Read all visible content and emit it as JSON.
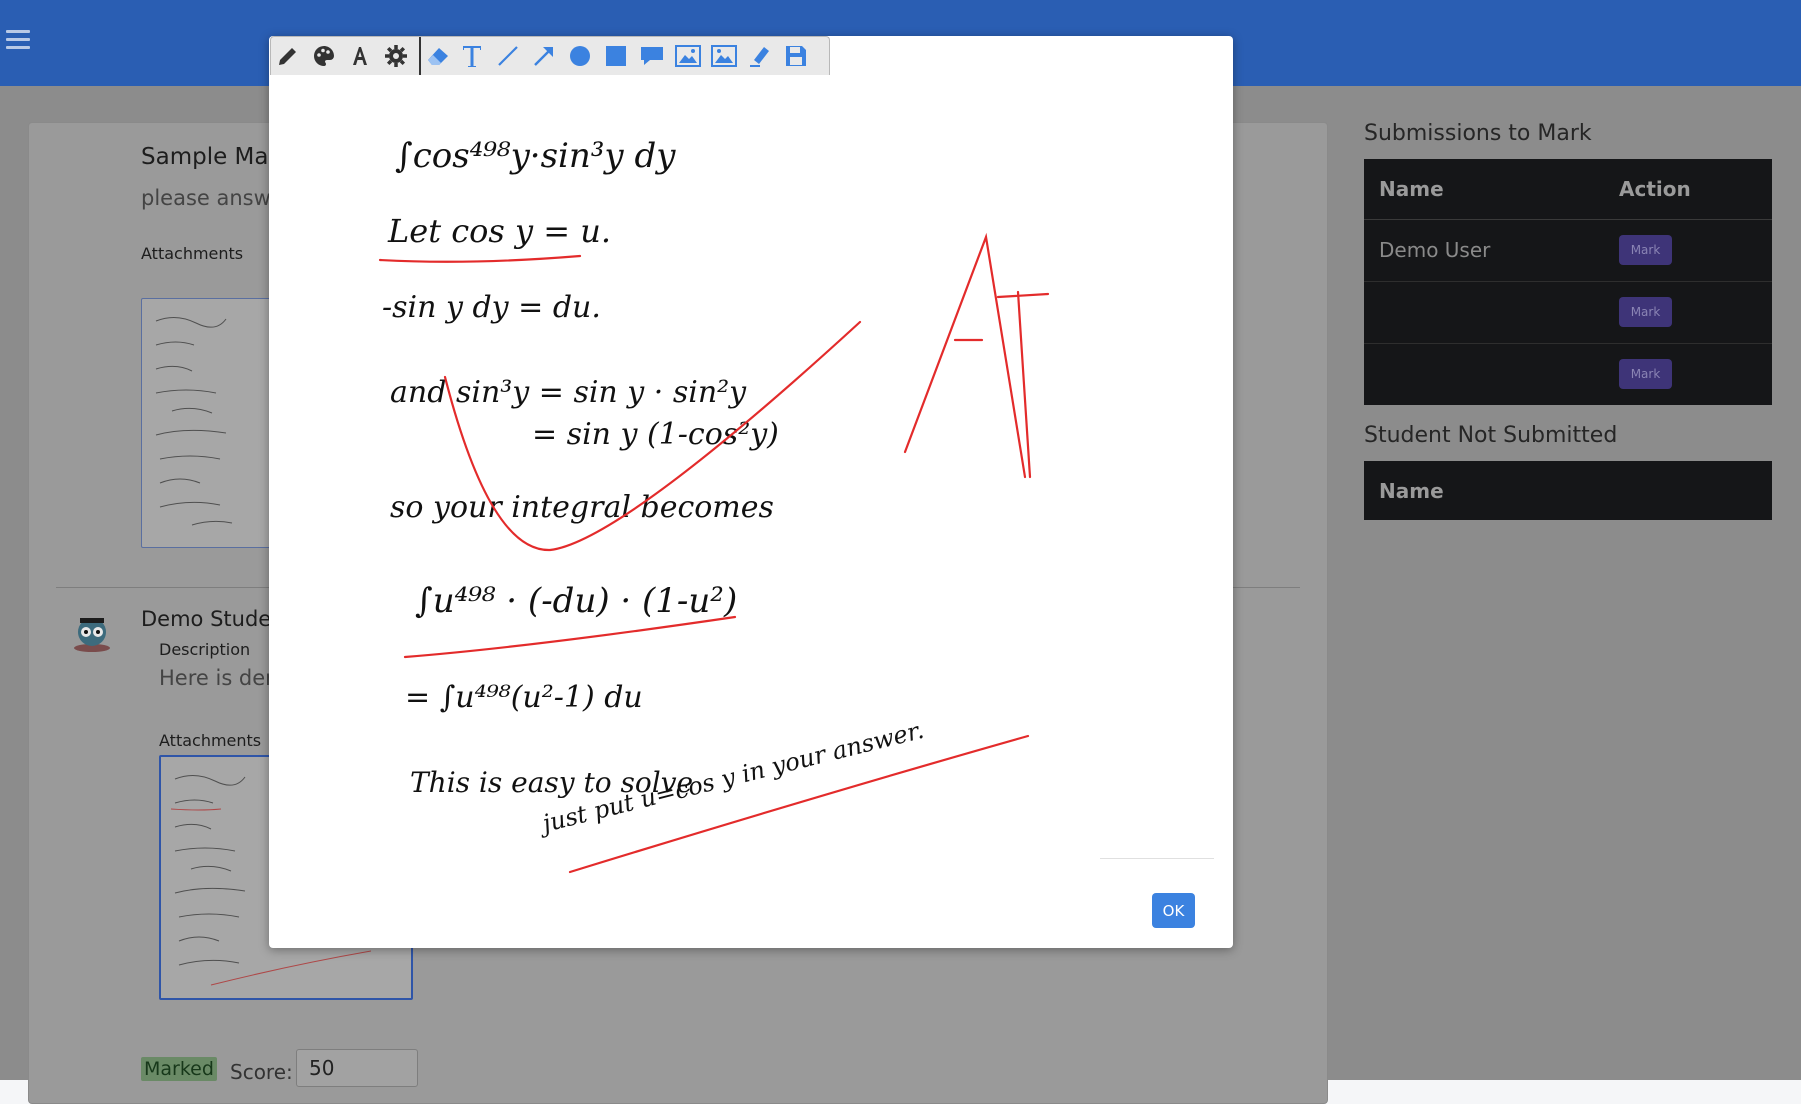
{
  "header": {
    "menu_icon": "hamburger-icon"
  },
  "assignment": {
    "title": "Sample Ma",
    "subtitle": "please answ",
    "attachments_label": "Attachments"
  },
  "submission": {
    "student_name": "Demo Studen",
    "description_label": "Description",
    "description_text": "Here is dem",
    "attachments_label": "Attachments",
    "status_badge": "Marked",
    "score_label": "Score:",
    "score_value": "50"
  },
  "sidebar": {
    "submissions_heading": "Submissions to Mark",
    "submissions_columns": {
      "name": "Name",
      "action": "Action"
    },
    "submissions_rows": [
      {
        "name": "Demo User",
        "action": "Mark"
      },
      {
        "name": "",
        "action": "Mark"
      },
      {
        "name": "",
        "action": "Mark"
      }
    ],
    "not_submitted_heading": "Student Not Submitted",
    "not_submitted_columns": {
      "name": "Name"
    }
  },
  "modal": {
    "ok_label": "OK",
    "toolbar": {
      "tools": [
        "pencil-icon",
        "palette-icon",
        "font-icon",
        "settings-icon",
        "eraser-icon",
        "text-icon",
        "line-icon",
        "arrow-icon",
        "circle-icon",
        "rectangle-icon",
        "comment-icon",
        "image-icon",
        "image-alt-icon",
        "highlighter-icon",
        "save-icon"
      ],
      "accent_color": "#3b82e0"
    },
    "annotation_color": "#e32b2b",
    "handwriting": {
      "line1": "∫cos⁴⁹⁸y·sin³y dy",
      "line2": "Let cos y = u.",
      "line3": "-sin y dy = du.",
      "line4": "and sin³y = sin y · sin²y",
      "line5": "= sin y (1-cos²y)",
      "line6": "so your integral becomes",
      "line7": "∫u⁴⁹⁸ · (-du) · (1-u²)",
      "line8": "= ∫u⁴⁹⁸(u²-1) du",
      "line9a": "This is easy to solve",
      "line9b": "just put u=cos y in your answer.",
      "grade": "A+"
    }
  }
}
